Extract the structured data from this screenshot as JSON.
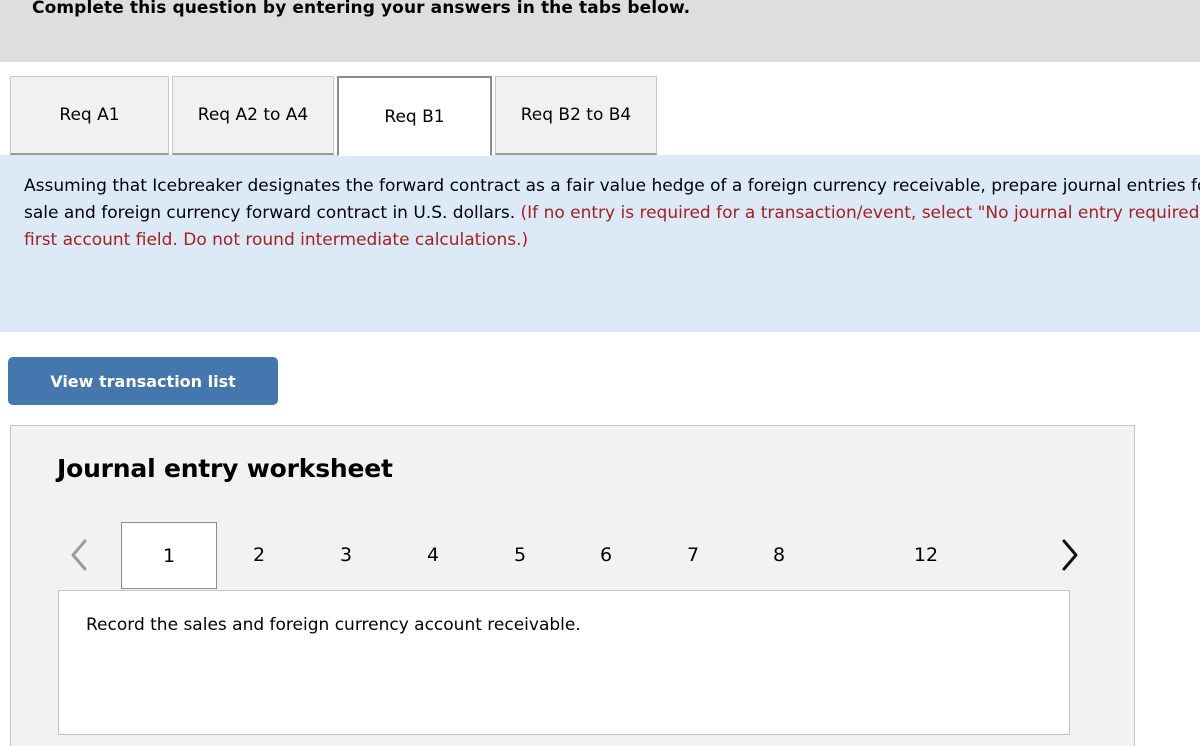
{
  "header": {
    "instruction": "Complete this question by entering your answers in the tabs below."
  },
  "requirement_tabs": {
    "items": [
      {
        "label": "Req A1",
        "active": false
      },
      {
        "label": "Req A2 to A4",
        "active": false
      },
      {
        "label": "Req B1",
        "active": true
      },
      {
        "label": "Req B2 to B4",
        "active": false
      }
    ]
  },
  "question": {
    "body": "Assuming that Icebreaker designates the forward contract as a fair value hedge of a foreign currency receivable, prepare journal entries for the sale and foreign currency forward contract in U.S. dollars. ",
    "hint": "(If no entry is required for a transaction/event, select \"No journal entry required\" in the first account field. Do not round intermediate calculations.)"
  },
  "toolbar": {
    "view_transaction_list_label": "View transaction list"
  },
  "worksheet": {
    "title": "Journal entry worksheet",
    "pager": {
      "prev_icon": "chevron-left-icon",
      "next_icon": "chevron-right-icon",
      "prev_enabled": false,
      "next_enabled": true,
      "pages": [
        "1",
        "2",
        "3",
        "4",
        "5",
        "6",
        "7",
        "8",
        "12"
      ],
      "active_page": "1"
    },
    "entry_description": "Record the sales and foreign currency account receivable."
  },
  "colors": {
    "header_band": "#dedede",
    "question_panel": "#dceaf7",
    "hint_text": "#a5201f",
    "primary_button": "#4477ae",
    "card_background": "#f2f2f2",
    "border": "#c4c4c4"
  }
}
